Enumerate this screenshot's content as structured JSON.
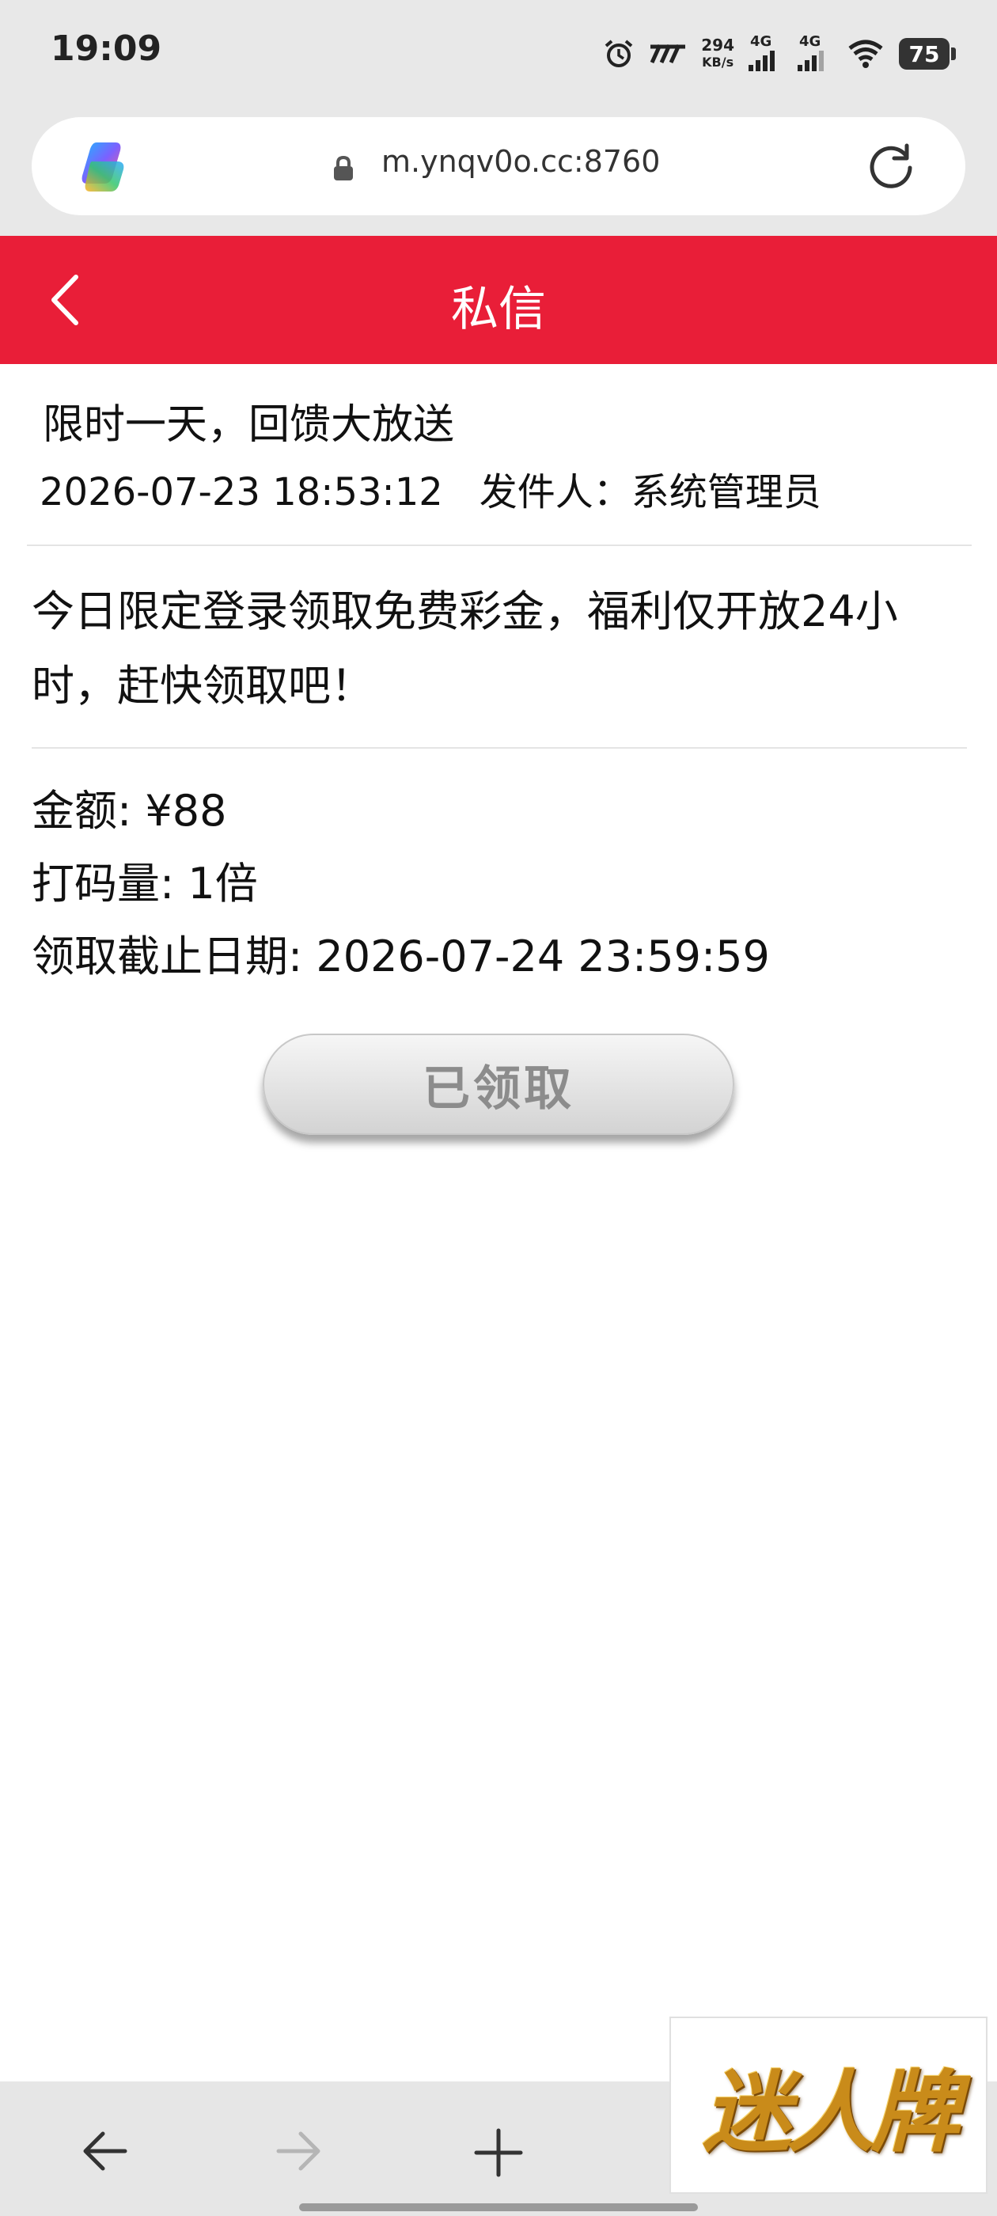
{
  "status_bar": {
    "time": "19:09",
    "net_speed_value": "294",
    "net_speed_unit": "KB/s",
    "sim1_label": "4G",
    "sim2_label": "4G",
    "battery": "75"
  },
  "browser": {
    "url": "m.ynqv0o.cc:8760"
  },
  "header": {
    "title": "私信"
  },
  "message": {
    "title": "限时一天，回馈大放送",
    "datetime": "2026-07-23 18:53:12",
    "sender": "发件人：系统管理员",
    "body": "今日限定登录领取免费彩金，福利仅开放24小时，赶快领取吧！",
    "amount": "金额: ¥88",
    "wager": "打码量: 1倍",
    "deadline": "领取截止日期: 2026-07-24 23:59:59",
    "claim_button": "已领取"
  },
  "watermark": {
    "text": "迷人牌"
  },
  "colors": {
    "header_red": "#e91e38",
    "claimed_button_text": "#8c8c8c"
  }
}
